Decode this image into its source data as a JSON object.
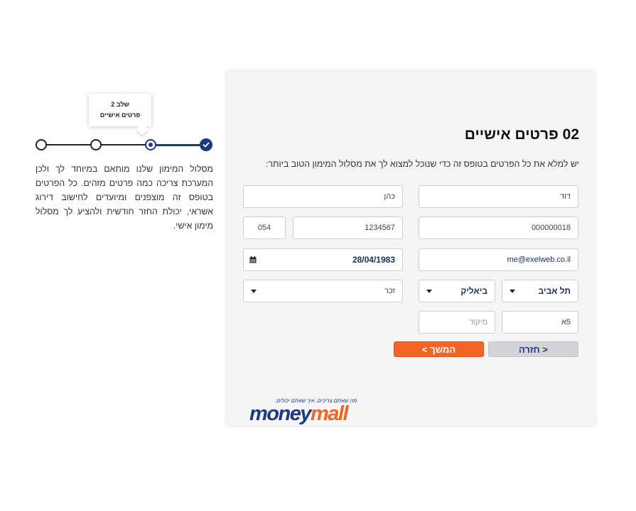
{
  "stepper": {
    "tooltip_step": "שלב 2",
    "tooltip_label": "פרטים אישיים",
    "description": "מסלול המימון שלנו מותאם במיוחד לך ולכן המערכת צריכה כמה פרטים מזהים. כל הפרטים בטופס זה מוצפנים ומיועדים לחישוב דירוג אשראי, יכולת החזר חודשית ולהציע לך מסלול מימון אישי."
  },
  "form": {
    "title": "02 פרטים אישיים",
    "subtitle": "יש למלא את כל הפרטים בטופס זה כדי שנוכל למצוא לך את מסלול המימון הטוב ביותר:",
    "first_name": "דוד",
    "last_name": "כהן",
    "id_number": "000000018",
    "phone": "1234567",
    "phone_prefix": "054",
    "email": "me@exelweb.co.il",
    "birth_date": "28/04/1983",
    "city": "תל אביב",
    "street": "ביאליק",
    "gender": "זכר",
    "house_number": "5א",
    "zip_placeholder": "מיקוד"
  },
  "buttons": {
    "next": "המשך >",
    "back": "< חזרה"
  },
  "logo": {
    "tagline": "מה שאתם צריכים. איך שאתם יכולים.",
    "word_money": "money",
    "word_mall": "mall"
  },
  "colors": {
    "brand_blue": "#1c3a82",
    "accent_orange": "#f26524"
  }
}
